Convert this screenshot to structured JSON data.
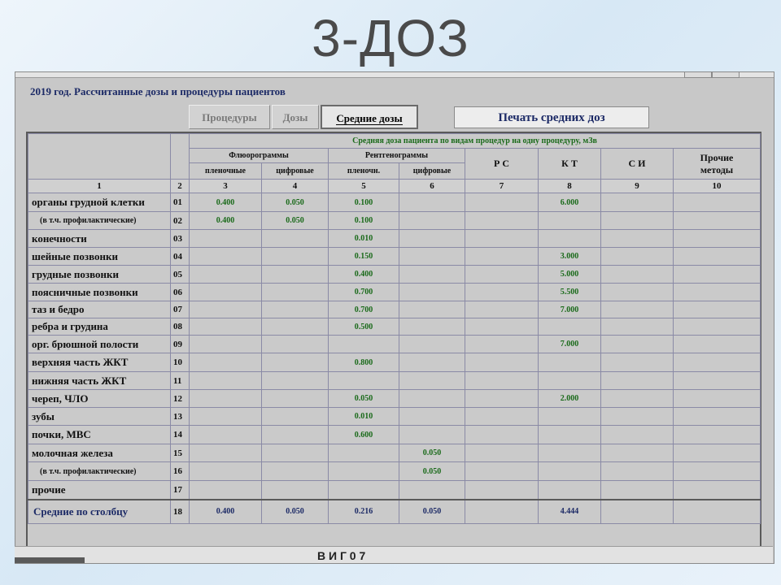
{
  "slide": {
    "title": "3-ДОЗ"
  },
  "window": {
    "title": "2019 год.   Рассчитанные дозы и процедуры пациентов",
    "tabs": [
      {
        "label": "Процедуры",
        "active": false
      },
      {
        "label": "Дозы",
        "active": false
      },
      {
        "label": "Средние дозы",
        "active": true
      }
    ],
    "print_button": "Печать средних доз",
    "bottom_text": "В   И   Г   0   7"
  },
  "table": {
    "header_top": "Средняя доза пациента по видам процедур на одну процедуру, мЗв",
    "group_fluoro": "Флюорограммы",
    "group_xray": "Рентгенограммы",
    "sub_fluoro_film": "пленочные",
    "sub_fluoro_digital": "цифровые",
    "sub_xray_film": "пленочн.",
    "sub_xray_digital": "цифровые",
    "col_rs": "Р С",
    "col_kt": "К Т",
    "col_si": "С И",
    "col_other_1": "Прочие",
    "col_other_2": "методы",
    "col_numbers": [
      "1",
      "2",
      "3",
      "4",
      "5",
      "6",
      "7",
      "8",
      "9",
      "10"
    ],
    "rows": [
      {
        "label": "органы грудной клетки",
        "code": "01",
        "values": [
          "0.400",
          "0.050",
          "0.100",
          "",
          "",
          "6.000",
          "",
          ""
        ]
      },
      {
        "label": "(в т.ч. профилактические)",
        "code": "02",
        "values": [
          "0.400",
          "0.050",
          "0.100",
          "",
          "",
          "",
          "",
          ""
        ]
      },
      {
        "label": "конечности",
        "code": "03",
        "values": [
          "",
          "",
          "0.010",
          "",
          "",
          "",
          "",
          ""
        ]
      },
      {
        "label": "шейные позвонки",
        "code": "04",
        "values": [
          "",
          "",
          "0.150",
          "",
          "",
          "3.000",
          "",
          ""
        ]
      },
      {
        "label": "грудные позвонки",
        "code": "05",
        "values": [
          "",
          "",
          "0.400",
          "",
          "",
          "5.000",
          "",
          ""
        ]
      },
      {
        "label": "поясничные позвонки",
        "code": "06",
        "values": [
          "",
          "",
          "0.700",
          "",
          "",
          "5.500",
          "",
          ""
        ]
      },
      {
        "label": "таз и бедро",
        "code": "07",
        "values": [
          "",
          "",
          "0.700",
          "",
          "",
          "7.000",
          "",
          ""
        ]
      },
      {
        "label": "ребра и грудина",
        "code": "08",
        "values": [
          "",
          "",
          "0.500",
          "",
          "",
          "",
          "",
          ""
        ]
      },
      {
        "label": "орг. брюшной полости",
        "code": "09",
        "values": [
          "",
          "",
          "",
          "",
          "",
          "7.000",
          "",
          ""
        ]
      },
      {
        "label": "верхняя часть ЖКТ",
        "code": "10",
        "values": [
          "",
          "",
          "0.800",
          "",
          "",
          "",
          "",
          ""
        ]
      },
      {
        "label": "нижняя часть ЖКТ",
        "code": "11",
        "values": [
          "",
          "",
          "",
          "",
          "",
          "",
          "",
          ""
        ]
      },
      {
        "label": "череп, ЧЛО",
        "code": "12",
        "values": [
          "",
          "",
          "0.050",
          "",
          "",
          "2.000",
          "",
          ""
        ]
      },
      {
        "label": "зубы",
        "code": "13",
        "values": [
          "",
          "",
          "0.010",
          "",
          "",
          "",
          "",
          ""
        ]
      },
      {
        "label": "почки, МВС",
        "code": "14",
        "values": [
          "",
          "",
          "0.600",
          "",
          "",
          "",
          "",
          ""
        ]
      },
      {
        "label": "молочная железа",
        "code": "15",
        "values": [
          "",
          "",
          "",
          "0.050",
          "",
          "",
          "",
          ""
        ]
      },
      {
        "label": "(в т.ч. профилактические)",
        "code": "16",
        "values": [
          "",
          "",
          "",
          "0.050",
          "",
          "",
          "",
          ""
        ]
      },
      {
        "label": "прочие",
        "code": "17",
        "values": [
          "",
          "",
          "",
          "",
          "",
          "",
          "",
          ""
        ]
      }
    ],
    "average_row": {
      "label": "Средние по столбцу",
      "code": "18",
      "values": [
        "0.400",
        "0.050",
        "0.216",
        "0.050",
        "",
        "4.444",
        "",
        ""
      ]
    }
  },
  "colors": {
    "title_text": "#1c2a66",
    "value_text": "#1a6a1a",
    "window_bg": "#c8c8c8"
  }
}
